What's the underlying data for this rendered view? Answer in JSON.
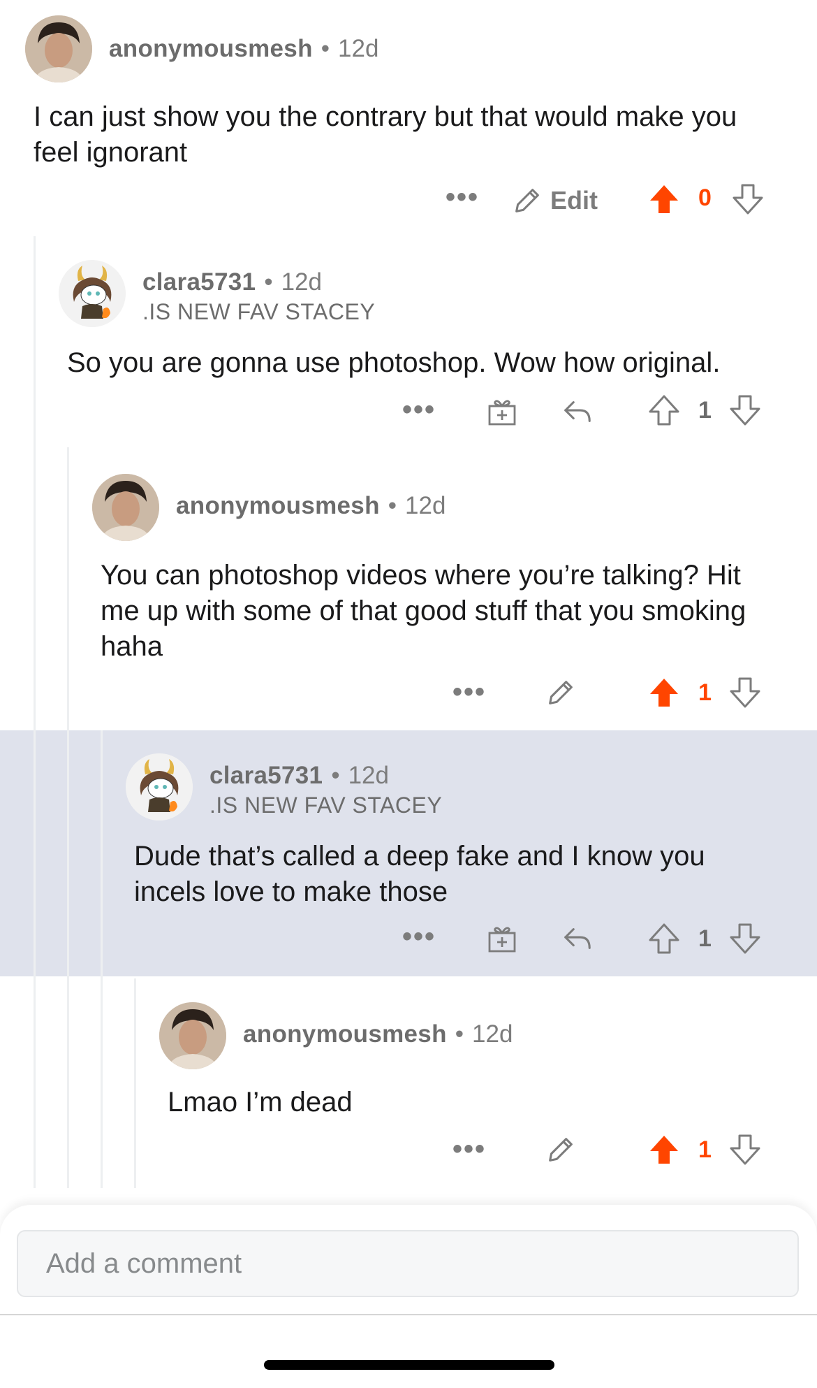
{
  "comments": [
    {
      "username": "anonymousmesh",
      "age": "12d",
      "flair": "",
      "body": "I can just show you the contrary but that would make you feel ignorant",
      "votes": "0",
      "upvoted": true,
      "edit_label": "Edit",
      "more": "•••"
    },
    {
      "username": "clara5731",
      "age": "12d",
      "flair": ".IS NEW FAV STACEY",
      "body": "So you are gonna use photoshop. Wow how original.",
      "votes": "1",
      "upvoted": false,
      "more": "•••"
    },
    {
      "username": "anonymousmesh",
      "age": "12d",
      "flair": "",
      "body": "You can photoshop videos where you’re talking? Hit me up with some of that good stuff that you smoking haha",
      "votes": "1",
      "upvoted": true,
      "more": "•••"
    },
    {
      "username": "clara5731",
      "age": "12d",
      "flair": ".IS NEW FAV STACEY",
      "body": "Dude that’s called a deep fake and I know you incels love to make those",
      "votes": "1",
      "upvoted": false,
      "more": "•••",
      "highlighted": true
    },
    {
      "username": "anonymousmesh",
      "age": "12d",
      "flair": "",
      "body": "Lmao I’m dead",
      "votes": "1",
      "upvoted": true,
      "more": "•••"
    }
  ],
  "separator": "•",
  "composer": {
    "placeholder": "Add a comment"
  },
  "colors": {
    "upvote": "#ff4500",
    "text": "#1a1a1b",
    "meta": "#7c7c7c",
    "highlight": "#dfe2ec"
  },
  "icons": [
    "pencil-icon",
    "upvote-icon",
    "downvote-icon",
    "reply-icon",
    "gift-icon",
    "more-icon"
  ]
}
